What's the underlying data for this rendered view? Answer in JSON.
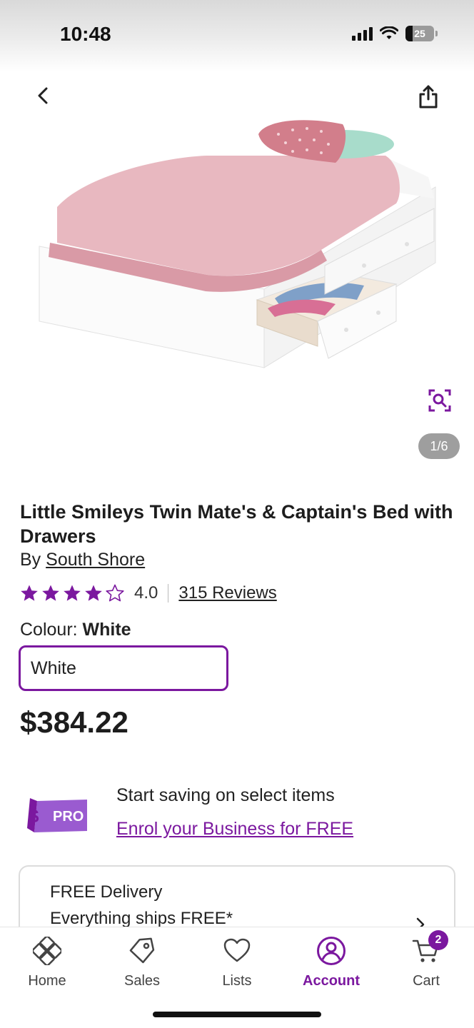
{
  "status_bar": {
    "time": "10:48",
    "battery_level": "25"
  },
  "header": {
    "back_icon": "chevron-left-icon",
    "share_icon": "share-icon"
  },
  "gallery": {
    "counter": "1/6",
    "current_image": 1,
    "total_images": 6,
    "zoom_icon": "zoom-icon"
  },
  "product": {
    "title": "Little Smileys Twin Mate's & Captain's Bed with Drawers",
    "by_label": "By",
    "brand": "South Shore",
    "rating": "4.0",
    "rating_value": 4.0,
    "rating_max": 5,
    "reviews": "315 Reviews",
    "colour_label": "Colour:",
    "colour_value": "White",
    "colour_option": "White",
    "price": "$384.22"
  },
  "pro_promo": {
    "logo_dollar": "$",
    "logo_text": "PRO",
    "text": "Start saving on select items",
    "link": "Enrol your Business for FREE"
  },
  "delivery": {
    "title": "FREE Delivery",
    "subtitle": "Everything ships FREE*"
  },
  "tab_bar": {
    "items": [
      {
        "label": "Home",
        "icon": "home-icon"
      },
      {
        "label": "Sales",
        "icon": "tag-icon"
      },
      {
        "label": "Lists",
        "icon": "heart-icon"
      },
      {
        "label": "Account",
        "icon": "account-icon"
      },
      {
        "label": "Cart",
        "icon": "cart-icon"
      }
    ],
    "active": "Account",
    "cart_count": "2"
  },
  "colors": {
    "accent": "#7b189f",
    "star": "#7b189f",
    "counter_bg": "#9e9e9e"
  }
}
